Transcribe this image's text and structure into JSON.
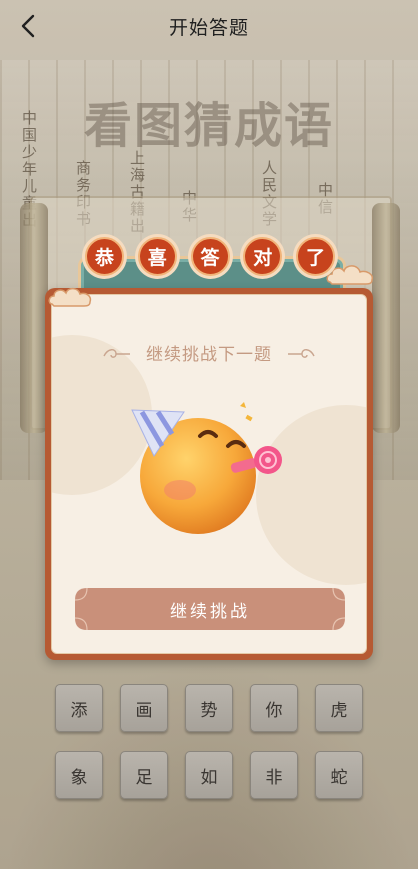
{
  "header": {
    "title": "开始答题",
    "back_icon": "chevron-left-icon"
  },
  "background": {
    "game_title": "看图猜成语",
    "book_spines": [
      "中国少年儿童出",
      "商务印书",
      "上海古籍出",
      "人民文学",
      "中华",
      "中信"
    ]
  },
  "dialog": {
    "banner_chars": [
      "恭",
      "喜",
      "答",
      "对",
      "了"
    ],
    "subtitle": "继续挑战下一题",
    "celebration_icon": "party-face-emoji",
    "continue_label": "继续挑战"
  },
  "answer_keys": [
    "添",
    "画",
    "势",
    "你",
    "虎",
    "象",
    "足",
    "如",
    "非",
    "蛇"
  ],
  "colors": {
    "badge_red": "#c7431d",
    "card_border": "#b65a33",
    "banner_teal": "#5c8f88",
    "button_brown": "#c9907a"
  }
}
